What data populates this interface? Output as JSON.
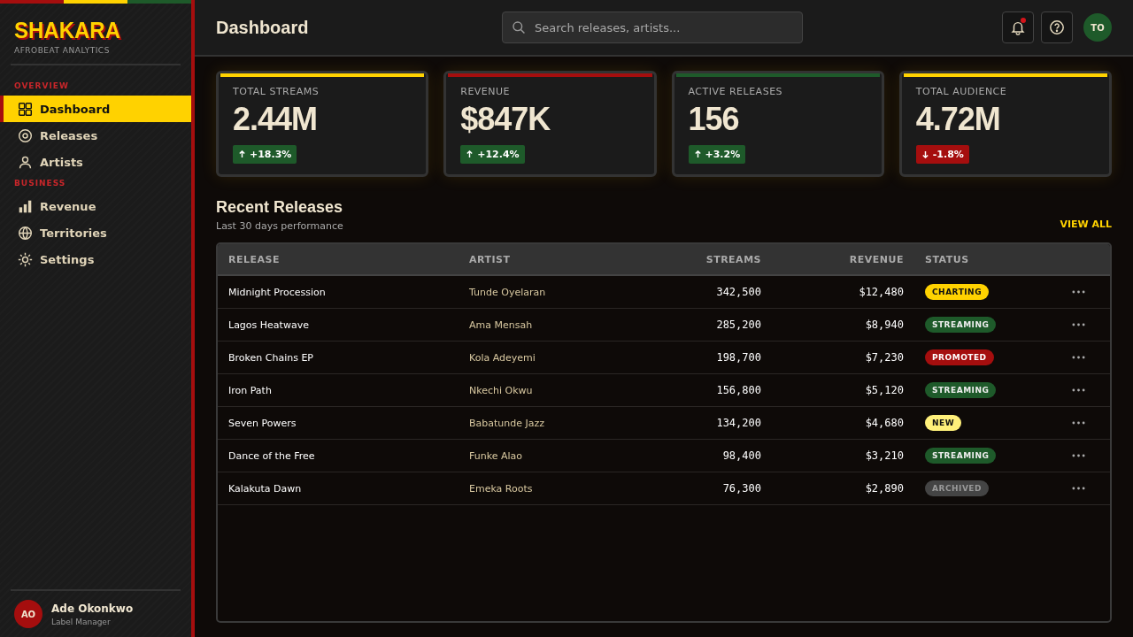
{
  "brand": {
    "name": "SHAKARA",
    "tagline": "AFROBEAT ANALYTICS"
  },
  "sidebar": {
    "sections": [
      {
        "title": "OVERVIEW",
        "items": [
          {
            "label": "Dashboard",
            "selected": true
          },
          {
            "label": "Releases",
            "selected": false
          },
          {
            "label": "Artists",
            "selected": false
          }
        ]
      },
      {
        "title": "BUSINESS",
        "items": [
          {
            "label": "Revenue",
            "selected": false
          },
          {
            "label": "Territories",
            "selected": false
          },
          {
            "label": "Settings",
            "selected": false
          }
        ]
      }
    ],
    "user": {
      "initials": "AO",
      "name": "Ade Okonkwo",
      "role": "Label Manager"
    }
  },
  "header": {
    "title": "Dashboard",
    "search": {
      "placeholder": "Search releases, artists..."
    },
    "notification_dot": true,
    "avatar": "TO"
  },
  "stats": [
    {
      "label": "TOTAL STREAMS",
      "value": "2.44M",
      "change": "+18.3%",
      "kind": "up",
      "color": "#ffd200"
    },
    {
      "label": "REVENUE",
      "value": "$847K",
      "change": "+12.4%",
      "kind": "up",
      "color": "#a50e0e"
    },
    {
      "label": "ACTIVE RELEASES",
      "value": "156",
      "change": "+3.2%",
      "kind": "up",
      "color": "#1e5a2a"
    },
    {
      "label": "TOTAL AUDIENCE",
      "value": "4.72M",
      "change": "-1.8%",
      "kind": "down",
      "color": "#ffd200"
    }
  ],
  "releases": {
    "title": "Recent Releases",
    "subtitle": "Last 30 days performance",
    "view_all": "VIEW ALL",
    "columns": [
      "RELEASE",
      "ARTIST",
      "STREAMS",
      "REVENUE",
      "STATUS"
    ],
    "rows": [
      {
        "release": "Midnight Procession",
        "artist": "Tunde Oyelaran",
        "streams": "342,500",
        "revenue": "$12,480",
        "status": "CHARTING",
        "kind": "charting"
      },
      {
        "release": "Lagos Heatwave",
        "artist": "Ama Mensah",
        "streams": "285,200",
        "revenue": "$8,940",
        "status": "STREAMING",
        "kind": "streaming"
      },
      {
        "release": "Broken Chains EP",
        "artist": "Kola Adeyemi",
        "streams": "198,700",
        "revenue": "$7,230",
        "status": "PROMOTED",
        "kind": "promoted"
      },
      {
        "release": "Iron Path",
        "artist": "Nkechi Okwu",
        "streams": "156,800",
        "revenue": "$5,120",
        "status": "STREAMING",
        "kind": "streaming"
      },
      {
        "release": "Seven Powers",
        "artist": "Babatunde Jazz",
        "streams": "134,200",
        "revenue": "$4,680",
        "status": "NEW",
        "kind": "new"
      },
      {
        "release": "Dance of the Free",
        "artist": "Funke Alao",
        "streams": "98,400",
        "revenue": "$3,210",
        "status": "STREAMING",
        "kind": "streaming"
      },
      {
        "release": "Kalakuta Dawn",
        "artist": "Emeka Roots",
        "streams": "76,300",
        "revenue": "$2,890",
        "status": "ARCHIVED",
        "kind": "archived"
      }
    ]
  }
}
